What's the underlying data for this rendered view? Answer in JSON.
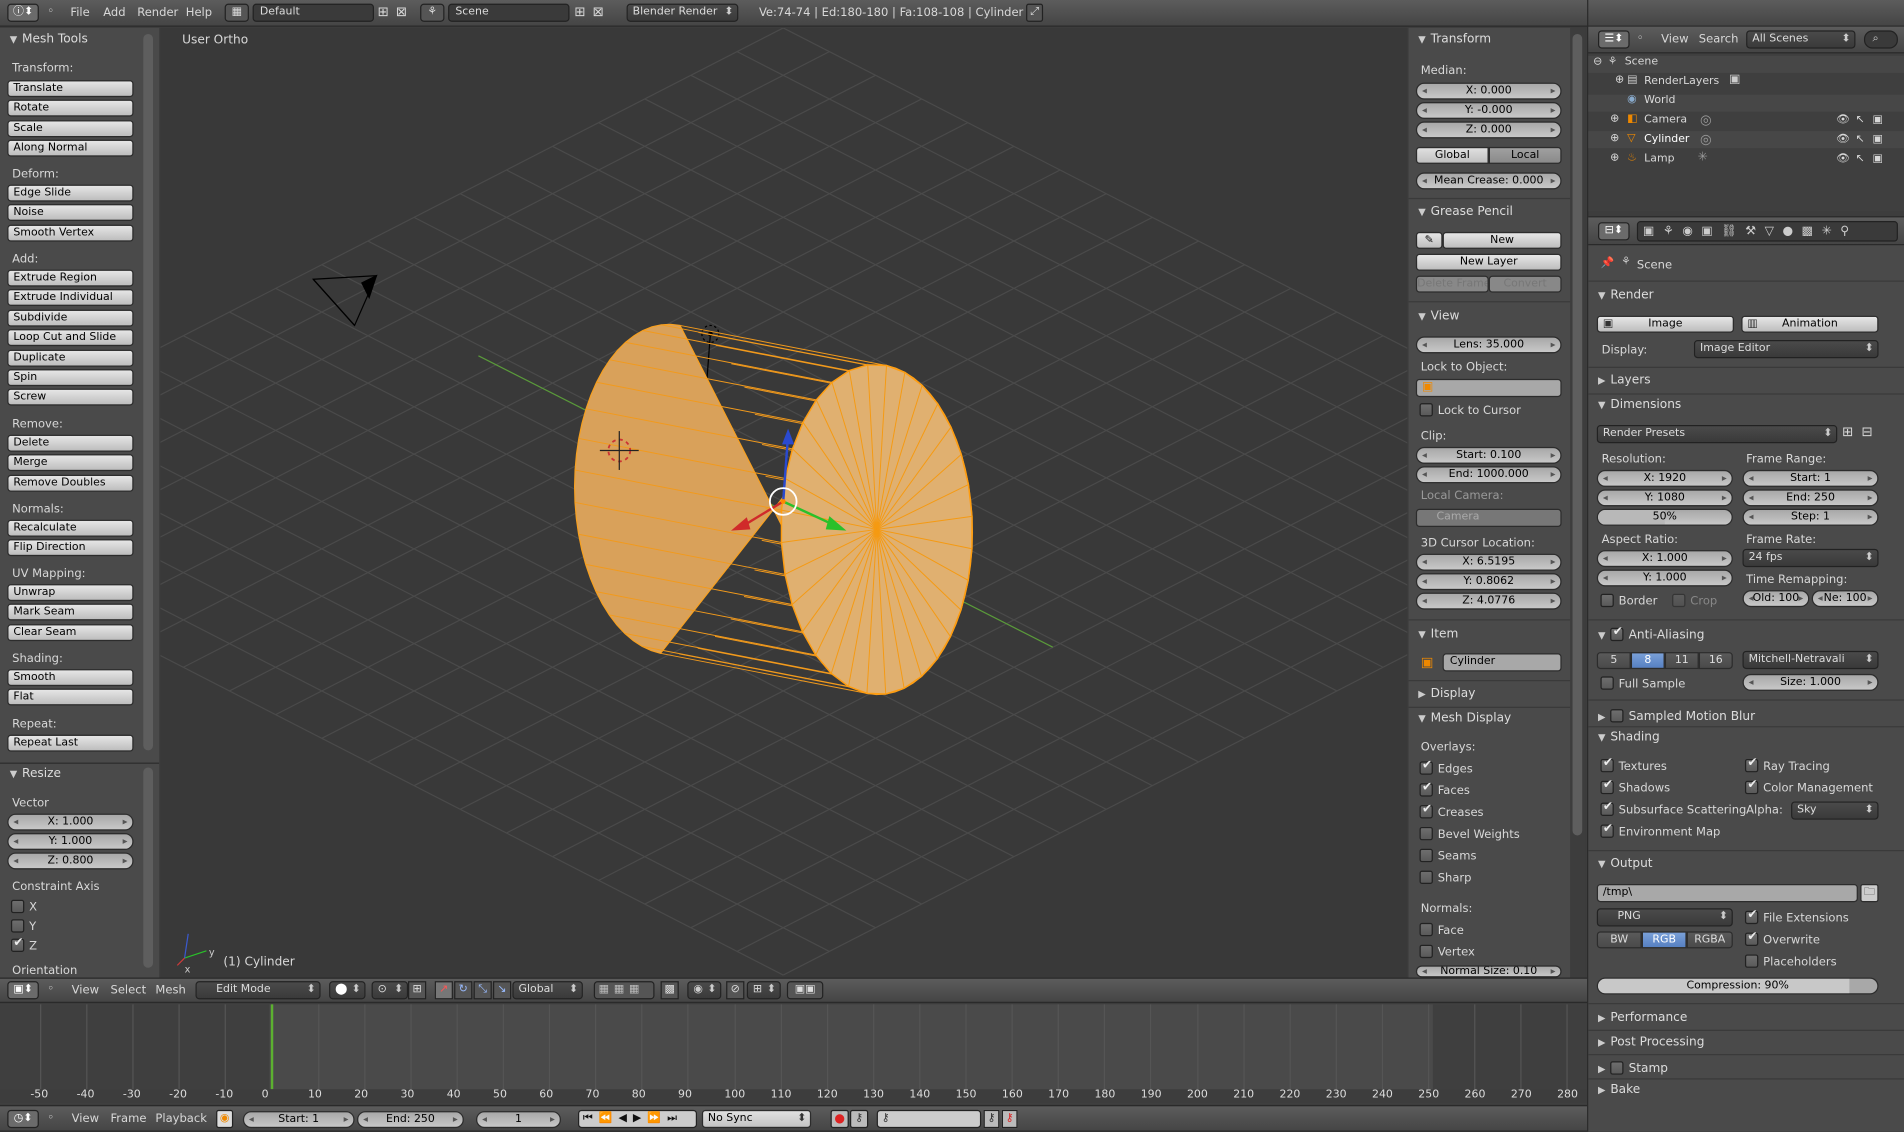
{
  "topbar": {
    "menus": [
      "File",
      "Add",
      "Render",
      "Help"
    ],
    "layout": "Default",
    "scene": "Scene",
    "engine": "Blender Render",
    "stats": "Ve:74-74 | Ed:180-180 | Fa:108-108 | Cylinder"
  },
  "toolshelf": {
    "title": "Mesh Tools",
    "groups": [
      {
        "label": "Transform:",
        "items": [
          "Translate",
          "Rotate",
          "Scale",
          "Along Normal"
        ]
      },
      {
        "label": "Deform:",
        "items": [
          "Edge Slide",
          "Noise",
          "Smooth Vertex"
        ]
      },
      {
        "label": "Add:",
        "items": [
          "Extrude Region",
          "Extrude Individual",
          "Subdivide",
          "Loop Cut and Slide",
          "Duplicate",
          "Spin",
          "Screw"
        ]
      },
      {
        "label": "Remove:",
        "items": [
          "Delete",
          "Merge",
          "Remove Doubles"
        ]
      },
      {
        "label": "Normals:",
        "items": [
          "Recalculate",
          "Flip Direction"
        ]
      },
      {
        "label": "UV Mapping:",
        "items": [
          "Unwrap",
          "Mark Seam",
          "Clear Seam"
        ]
      },
      {
        "label": "Shading:",
        "items": [
          "Smooth",
          "Flat"
        ]
      },
      {
        "label": "Repeat:",
        "items": [
          "Repeat Last"
        ]
      }
    ]
  },
  "operator": {
    "title": "Resize",
    "vector_label": "Vector",
    "x": "X: 1.000",
    "y": "Y: 1.000",
    "z": "Z: 0.800",
    "constraint_label": "Constraint Axis",
    "cx": "X",
    "cy": "Y",
    "cz": "Z",
    "orientation": "Orientation"
  },
  "viewport": {
    "view_name": "User Ortho",
    "object_label": "(1) Cylinder"
  },
  "npanel": {
    "transform": {
      "title": "Transform",
      "median": "Median:",
      "x": "X: 0.000",
      "y": "Y: -0.000",
      "z": "Z: 0.000",
      "global": "Global",
      "local": "Local",
      "crease": "Mean Crease: 0.000"
    },
    "gpencil": {
      "title": "Grease Pencil",
      "new": "New",
      "new_layer": "New Layer",
      "delete_frame": "Delete Frame",
      "convert": "Convert"
    },
    "view": {
      "title": "View",
      "lens": "Lens: 35.000",
      "lock_obj": "Lock to Object:",
      "lock_cursor": "Lock to Cursor",
      "clip": "Clip:",
      "start": "Start: 0.100",
      "end": "End: 1000.000",
      "local_cam": "Local Camera:",
      "camera": "Camera",
      "cursor": "3D Cursor Location:",
      "cx": "X: 6.5195",
      "cy": "Y: 0.8062",
      "cz": "Z: 4.0776"
    },
    "item": {
      "title": "Item",
      "name": "Cylinder"
    },
    "display": {
      "title": "Display"
    },
    "meshdisplay": {
      "title": "Mesh Display",
      "overlays": "Overlays:",
      "edges": "Edges",
      "faces": "Faces",
      "creases": "Creases",
      "bevel": "Bevel Weights",
      "seams": "Seams",
      "sharp": "Sharp",
      "normals": "Normals:",
      "face": "Face",
      "vertex": "Vertex",
      "normal_size": "Normal Size: 0.10"
    }
  },
  "viewheader": {
    "menus": [
      "View",
      "Select",
      "Mesh"
    ],
    "mode": "Edit Mode",
    "orientation": "Global"
  },
  "outliner": {
    "menus": [
      "View",
      "Search"
    ],
    "filter": "All Scenes",
    "items": [
      "Scene",
      "RenderLayers",
      "World",
      "Camera",
      "Cylinder",
      "Lamp"
    ]
  },
  "props": {
    "context": "Scene",
    "render": {
      "title": "Render",
      "image": "Image",
      "animation": "Animation",
      "display_label": "Display:",
      "display": "Image Editor"
    },
    "layers": "Layers",
    "dimensions": {
      "title": "Dimensions",
      "presets": "Render Presets",
      "res": "Resolution:",
      "rx": "X: 1920",
      "ry": "Y: 1080",
      "pct": "50%",
      "frange": "Frame Range:",
      "fstart": "Start: 1",
      "fend": "End: 250",
      "fstep": "Step: 1",
      "aspect": "Aspect Ratio:",
      "ax": "X: 1.000",
      "ay": "Y: 1.000",
      "frate": "Frame Rate:",
      "fps": "24 fps",
      "remap": "Time Remapping:",
      "old": "Old: 100",
      "new": "Ne: 100",
      "border": "Border",
      "crop": "Crop"
    },
    "aa": {
      "title": "Anti-Aliasing",
      "levels": [
        "5",
        "8",
        "11",
        "16"
      ],
      "filter": "Mitchell-Netravali",
      "full": "Full Sample",
      "size": "Size: 1.000"
    },
    "smb": "Sampled Motion Blur",
    "shading": {
      "title": "Shading",
      "textures": "Textures",
      "raytracing": "Ray Tracing",
      "shadows": "Shadows",
      "colormgmt": "Color Management",
      "sss": "Subsurface Scattering",
      "alpha_label": "Alpha:",
      "alpha": "Sky",
      "envmap": "Environment Map"
    },
    "output": {
      "title": "Output",
      "path": "/tmp\\",
      "format": "PNG",
      "fileext": "File Extensions",
      "bw": "BW",
      "rgb": "RGB",
      "rgba": "RGBA",
      "overwrite": "Overwrite",
      "placeholders": "Placeholders",
      "compression": "Compression: 90%"
    },
    "closed": [
      "Performance",
      "Post Processing",
      "Stamp",
      "Bake"
    ]
  },
  "timeline": {
    "ticks": [
      "-50",
      "-40",
      "-30",
      "-20",
      "-10",
      "0",
      "10",
      "20",
      "30",
      "40",
      "50",
      "60",
      "70",
      "80",
      "90",
      "100",
      "110",
      "120",
      "130",
      "140",
      "150",
      "160",
      "170",
      "180",
      "190",
      "200",
      "210",
      "220",
      "230",
      "240",
      "250",
      "260",
      "270",
      "280"
    ],
    "menus": [
      "View",
      "Frame",
      "Playback"
    ],
    "start": "Start: 1",
    "end": "End: 250",
    "current": "1",
    "sync": "No Sync"
  }
}
